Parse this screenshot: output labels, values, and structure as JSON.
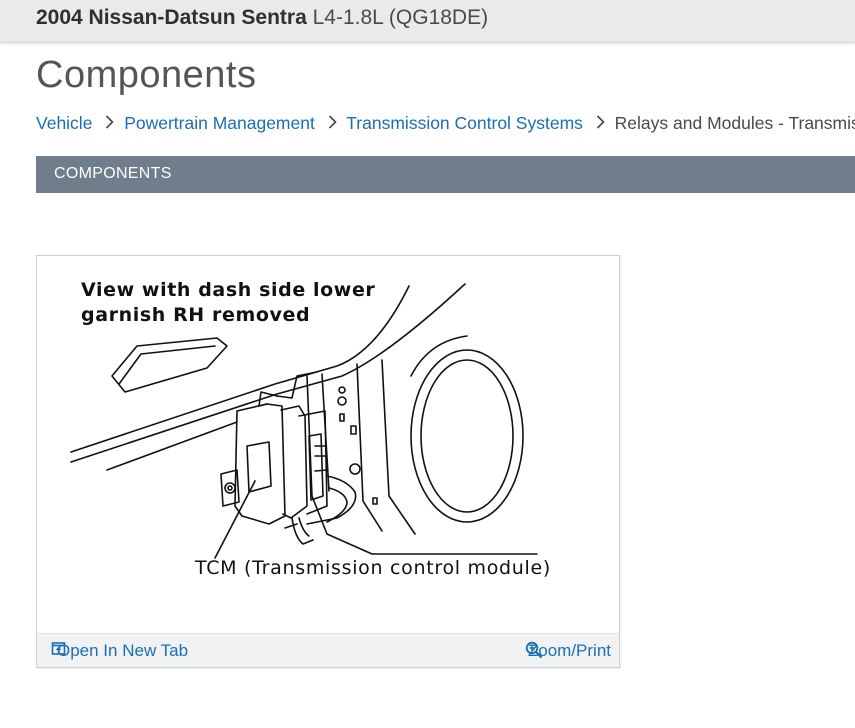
{
  "header": {
    "vehicle_make_model": "2004 Nissan-Datsun Sentra",
    "engine": "L4-1.8L (QG18DE)"
  },
  "page": {
    "title": "Components"
  },
  "breadcrumb": [
    {
      "label": "Vehicle"
    },
    {
      "label": "Powertrain Management"
    },
    {
      "label": "Transmission Control Systems"
    },
    {
      "label": "Relays and Modules - Transmissi"
    }
  ],
  "section": {
    "title": "COMPONENTS"
  },
  "figure": {
    "caption_line1": "View with dash side lower",
    "caption_line2": "garnish RH removed",
    "callout": "TCM (Transmission control module)",
    "open_tab_label": "Open In New Tab",
    "zoom_label": "Zoom/Print"
  },
  "icons": {
    "breadcrumb_separator": "chevron-right-icon",
    "open_tab": "open-new-tab-icon",
    "zoom": "magnifier-zoom-icon"
  },
  "colors": {
    "link": "#1a6fb3",
    "section_bar": "#707d8a",
    "topbar": "#e9eaec"
  }
}
